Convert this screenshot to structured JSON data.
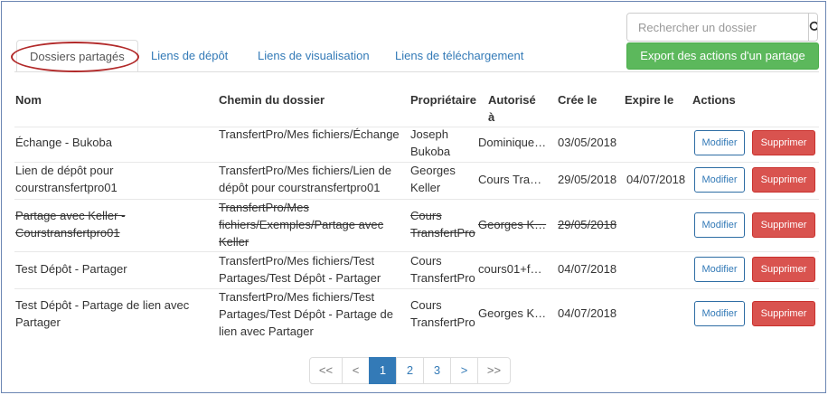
{
  "search": {
    "placeholder": "Rechercher un dossier",
    "icon": "search-icon"
  },
  "export_label": "Export des actions d'un partage",
  "tabs": [
    {
      "label": "Dossiers partagés",
      "active": true
    },
    {
      "label": "Liens de dépôt"
    },
    {
      "label": "Liens de visualisation"
    },
    {
      "label": "Liens de téléchargement"
    }
  ],
  "columns": {
    "nom": "Nom",
    "chemin": "Chemin du dossier",
    "proprietaire": "Propriétaire",
    "autorise": "Autorisé à",
    "cree": "Crée le",
    "expire": "Expire le",
    "actions": "Actions"
  },
  "rows": [
    {
      "nom": "Échange - Bukoba",
      "chemin": "TransfertPro/Mes fichiers/Échange",
      "proprietaire": "Joseph Bukoba",
      "autorise": "Dominique…",
      "cree": "03/05/2018",
      "expire": "",
      "struck": false
    },
    {
      "nom": "Lien de dépôt pour courstransfertpro01",
      "chemin": "TransfertPro/Mes fichiers/Lien de dépôt pour courstransfertpro01",
      "proprietaire": "Georges Keller",
      "autorise": "Cours Tra…",
      "cree": "29/05/2018",
      "expire": "04/07/2018",
      "struck": false
    },
    {
      "nom": "Partage avec Keller - Courstransfertpro01",
      "chemin": "TransfertPro/Mes fichiers/Exemples/Partage avec Keller",
      "proprietaire": "Cours TransfertPro",
      "autorise": "Georges K…",
      "cree": "29/05/2018",
      "expire": "",
      "struck": true
    },
    {
      "nom": "Test Dépôt - Partager",
      "chemin": "TransfertPro/Mes fichiers/Test Partages/Test Dépôt - Partager",
      "proprietaire": "Cours TransfertPro",
      "autorise": "cours01+f…",
      "cree": "04/07/2018",
      "expire": "",
      "struck": false
    },
    {
      "nom": "Test Dépôt - Partage de lien avec Partager",
      "chemin": "TransfertPro/Mes fichiers/Test Partages/Test Dépôt - Partage de lien avec Partager",
      "proprietaire": "Cours TransfertPro",
      "autorise": "Georges K…",
      "cree": "04/07/2018",
      "expire": "",
      "struck": false
    }
  ],
  "actions": {
    "modifier": "Modifier",
    "supprimer": "Supprimer"
  },
  "pagination": {
    "first": "<<",
    "prev": "<",
    "pages": [
      "1",
      "2",
      "3"
    ],
    "current": "1",
    "next": ">",
    "last": ">>"
  },
  "colors": {
    "primary": "#337ab7",
    "success": "#5cb85c",
    "danger": "#d9534f",
    "highlight": "#b22a2a"
  }
}
